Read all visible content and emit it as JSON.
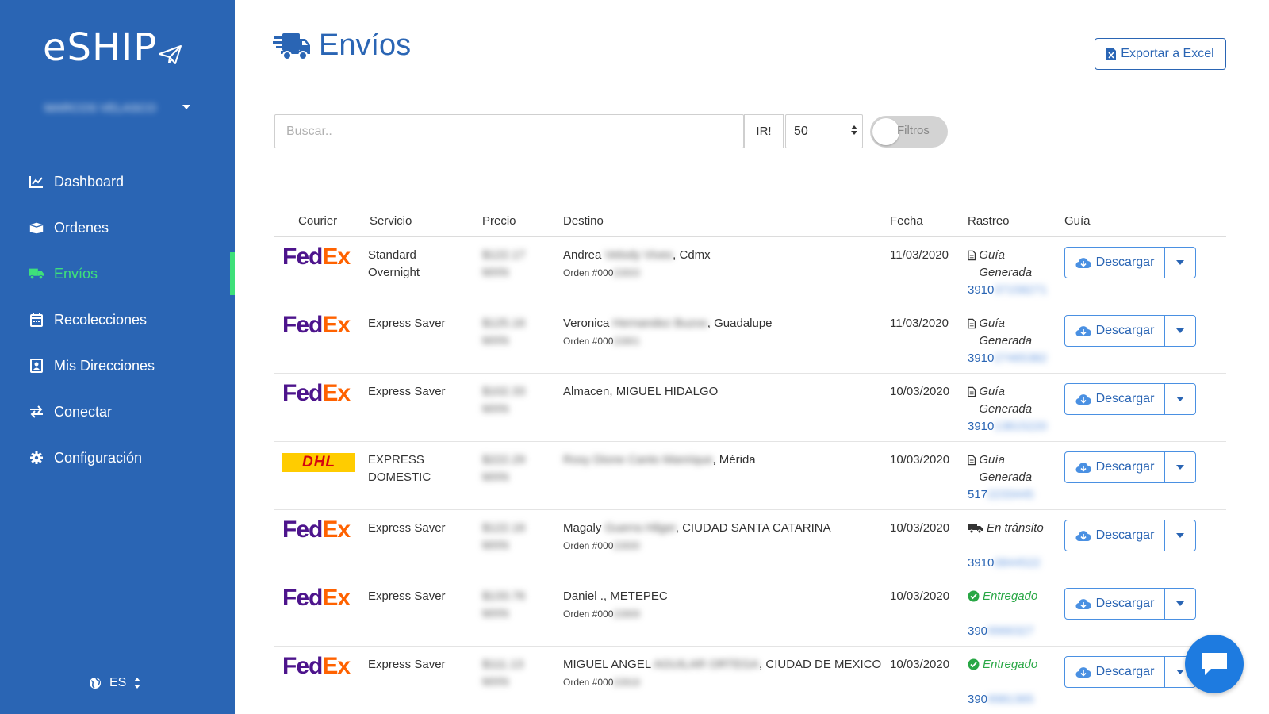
{
  "app": {
    "logo_text": "eSHIP",
    "user_name": "MARCOS VELASCO"
  },
  "sidebar": {
    "items": [
      {
        "label": "Dashboard",
        "icon": "chart-line-icon",
        "active": false
      },
      {
        "label": "Ordenes",
        "icon": "box-open-icon",
        "active": false
      },
      {
        "label": "Envíos",
        "icon": "truck-icon",
        "active": true
      },
      {
        "label": "Recolecciones",
        "icon": "calendar-icon",
        "active": false
      },
      {
        "label": "Mis Direcciones",
        "icon": "address-book-icon",
        "active": false
      },
      {
        "label": "Conectar",
        "icon": "exchange-icon",
        "active": false
      },
      {
        "label": "Configuración",
        "icon": "gear-icon",
        "active": false
      }
    ],
    "language": "ES"
  },
  "header": {
    "title": "Envíos",
    "export_label": "Exportar a Excel"
  },
  "toolbar": {
    "search_placeholder": "Buscar..",
    "go_label": "IR!",
    "per_page": "50",
    "filters_label": "Filtros"
  },
  "table": {
    "headers": [
      "Courier",
      "Servicio",
      "Precio",
      "Destino",
      "Fecha",
      "Rastreo",
      "Guía"
    ],
    "download_label": "Descargar",
    "rows": [
      {
        "courier": "FedEx",
        "service": "Standard Overnight",
        "price": "$122.17 MXN",
        "dest_first": "Andrea",
        "dest_hidden": "Velody Vives",
        "dest_city": ", Cdmx",
        "order": "Orden #000",
        "order_hidden": "22833",
        "date": "11/03/2020",
        "status": "Guía Generada",
        "status_type": "guide",
        "tracking": "3910",
        "tracking_hidden": "37158271"
      },
      {
        "courier": "FedEx",
        "service": "Express Saver",
        "price": "$125.16 MXN",
        "dest_first": "Veronica",
        "dest_hidden": "Hernandez Buzos",
        "dest_city": ", Guadalupe",
        "order": "Orden #000",
        "order_hidden": "22801",
        "date": "11/03/2020",
        "status": "Guía Generada",
        "status_type": "guide",
        "tracking": "3910",
        "tracking_hidden": "27465382"
      },
      {
        "courier": "FedEx",
        "service": "Express Saver",
        "price": "$102.33 MXN",
        "dest_first": "Almacen, MIGUEL HIDALGO",
        "dest_hidden": "",
        "dest_city": "",
        "order": "",
        "order_hidden": "",
        "date": "10/03/2020",
        "status": "Guía Generada",
        "status_type": "guide",
        "tracking": "3910",
        "tracking_hidden": "13815220"
      },
      {
        "courier": "DHL",
        "service": "EXPRESS DOMESTIC",
        "price": "$222.29 MXN",
        "dest_first": "",
        "dest_hidden": "Rosy Dione Canto Manrique",
        "dest_city": ", Mérida",
        "order": "",
        "order_hidden": "",
        "date": "10/03/2020",
        "status": "Guía Generada",
        "status_type": "guide",
        "tracking": "517",
        "tracking_hidden": "2233445"
      },
      {
        "courier": "FedEx",
        "service": "Express Saver",
        "price": "$122.16 MXN",
        "dest_first": "Magaly",
        "dest_hidden": "Guerra Hilger",
        "dest_city": ", CIUDAD SANTA CATARINA",
        "order": "Orden #000",
        "order_hidden": "22830",
        "date": "10/03/2020",
        "status": "En tránsito",
        "status_type": "transit",
        "tracking": "3910",
        "tracking_hidden": "0844522"
      },
      {
        "courier": "FedEx",
        "service": "Express Saver",
        "price": "$133.76 MXN",
        "dest_first": "Daniel ., METEPEC",
        "dest_hidden": "",
        "dest_city": "",
        "order": "Orden #000",
        "order_hidden": "22809",
        "date": "10/03/2020",
        "status": "Entregado",
        "status_type": "delivered",
        "tracking": "390",
        "tracking_hidden": "9966327"
      },
      {
        "courier": "FedEx",
        "service": "Express Saver",
        "price": "$111.13 MXN",
        "dest_first": "MIGUEL ANGEL",
        "dest_hidden": "AGUILAR ORTEGA",
        "dest_city": ", CIUDAD DE MEXICO",
        "order": "Orden #000",
        "order_hidden": "22818",
        "date": "10/03/2020",
        "status": "Entregado",
        "status_type": "delivered",
        "tracking": "390",
        "tracking_hidden": "9981365"
      }
    ]
  },
  "colors": {
    "sidebar_bg": "#2a65b4",
    "active": "#3ee07a",
    "accent": "#2a65b4",
    "success": "#28a745"
  }
}
